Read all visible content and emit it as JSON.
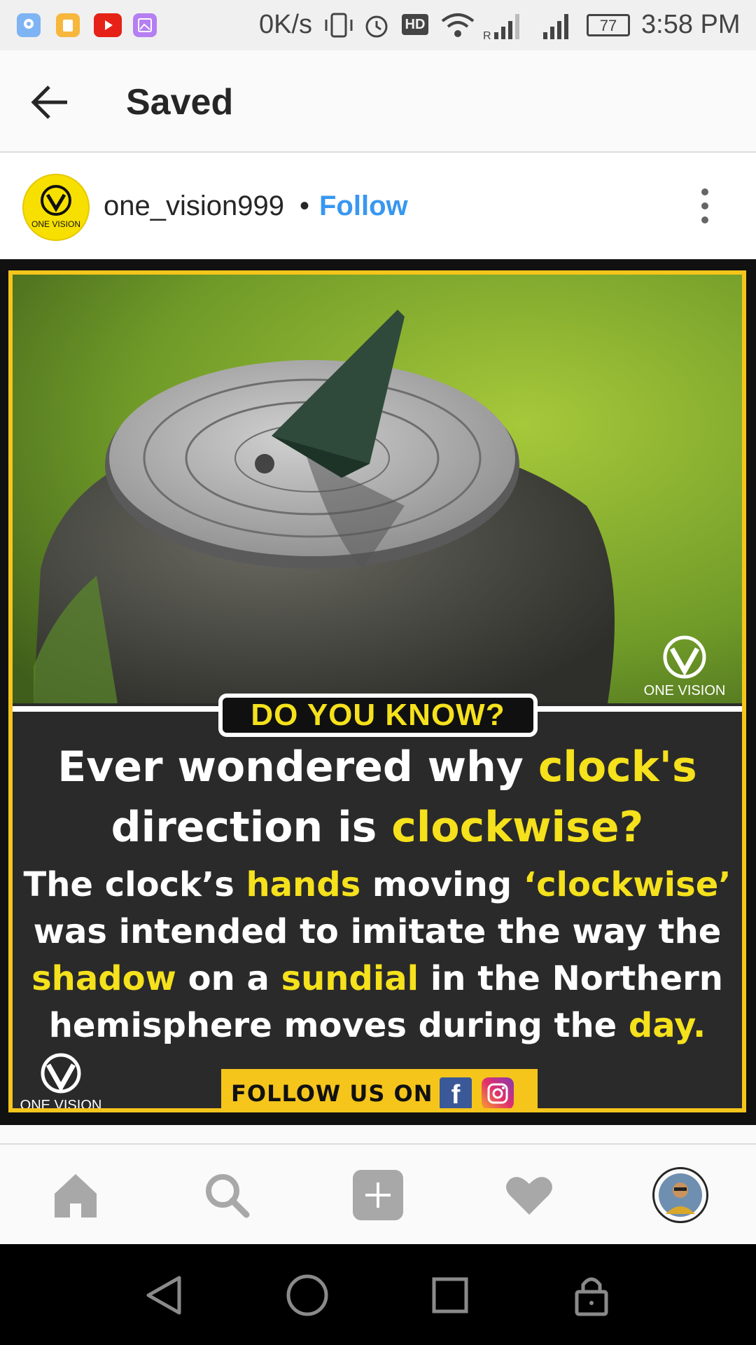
{
  "status_bar": {
    "net_speed": "0K/s",
    "hd_badge": "HD",
    "battery": "77",
    "time": "3:58 PM",
    "app_icons": [
      "maps-icon",
      "files-icon",
      "youtube-icon",
      "gallery-icon"
    ]
  },
  "app_bar": {
    "title": "Saved"
  },
  "post": {
    "username": "one_vision999",
    "separator": "•",
    "follow_label": "Follow",
    "avatar_text": "ONE VISION",
    "image": {
      "banner": "DO YOU KNOW?",
      "headline_1a": "Ever wondered why ",
      "headline_1b": "clock's",
      "headline_2a": "direction is ",
      "headline_2b": "clockwise?",
      "body_1a": "The clock’s ",
      "body_1b": "hands",
      "body_1c": " moving ",
      "body_1d": "‘clockwise’",
      "body_2": "was intended to imitate the way the",
      "body_3a": "shadow",
      "body_3b": " on a ",
      "body_3c": "sundial",
      "body_3d": " in the Northern",
      "body_4a": "hemisphere moves during the ",
      "body_4b": "day.",
      "logo_text": "ONE VISION",
      "follow_us": "FOLLOW US ON",
      "fb_letter": "f"
    }
  },
  "colors": {
    "accent_blue": "#3897f0",
    "brand_yellow": "#f5c51c",
    "highlight_yellow": "#f5e11c"
  },
  "bottom_nav": [
    "home-icon",
    "search-icon",
    "add-post-icon",
    "activity-heart-icon",
    "profile-avatar"
  ],
  "system_nav": [
    "back-icon",
    "home-circle-icon",
    "recents-icon",
    "lock-icon"
  ]
}
